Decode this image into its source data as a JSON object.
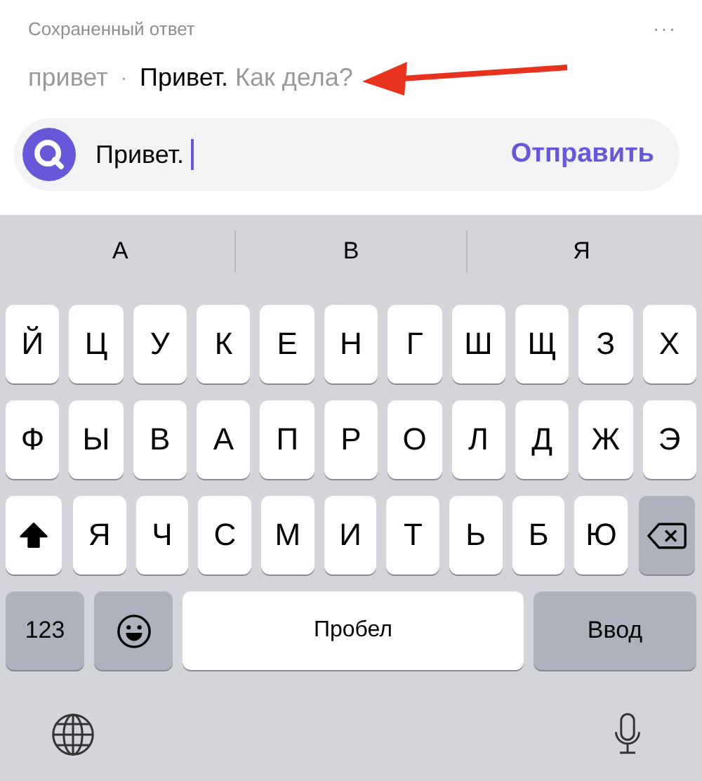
{
  "header": {
    "title": "Сохраненный ответ",
    "more": "···"
  },
  "suggestion": {
    "query": "привет",
    "separator": "·",
    "answer": "**Привет.** Как дела?"
  },
  "input": {
    "value": "Привет.",
    "send": "Отправить"
  },
  "predictions": [
    "А",
    "В",
    "Я"
  ],
  "keyboard": {
    "rows": [
      [
        {
          "kind": "letter",
          "label": "Й"
        },
        {
          "kind": "letter",
          "label": "Ц"
        },
        {
          "kind": "letter",
          "label": "У"
        },
        {
          "kind": "letter",
          "label": "К"
        },
        {
          "kind": "letter",
          "label": "Е"
        },
        {
          "kind": "letter",
          "label": "Н"
        },
        {
          "kind": "letter",
          "label": "Г"
        },
        {
          "kind": "letter",
          "label": "Ш"
        },
        {
          "kind": "letter",
          "label": "Щ"
        },
        {
          "kind": "letter",
          "label": "З"
        },
        {
          "kind": "letter",
          "label": "Х"
        }
      ],
      [
        {
          "kind": "letter",
          "label": "Ф"
        },
        {
          "kind": "letter",
          "label": "Ы"
        },
        {
          "kind": "letter",
          "label": "В"
        },
        {
          "kind": "letter",
          "label": "А"
        },
        {
          "kind": "letter",
          "label": "П"
        },
        {
          "kind": "letter",
          "label": "Р"
        },
        {
          "kind": "letter",
          "label": "О"
        },
        {
          "kind": "letter",
          "label": "Л"
        },
        {
          "kind": "letter",
          "label": "Д"
        },
        {
          "kind": "letter",
          "label": "Ж"
        },
        {
          "kind": "letter",
          "label": "Э"
        }
      ],
      [
        {
          "kind": "shift",
          "on": true
        },
        {
          "kind": "letter",
          "label": "Я"
        },
        {
          "kind": "letter",
          "label": "Ч"
        },
        {
          "kind": "letter",
          "label": "С"
        },
        {
          "kind": "letter",
          "label": "М"
        },
        {
          "kind": "letter",
          "label": "И"
        },
        {
          "kind": "letter",
          "label": "Т"
        },
        {
          "kind": "letter",
          "label": "Ь"
        },
        {
          "kind": "letter",
          "label": "Б"
        },
        {
          "kind": "letter",
          "label": "Ю"
        },
        {
          "kind": "backspace"
        }
      ]
    ],
    "function_keys": [
      {
        "kind": "numbers",
        "label": "123"
      },
      {
        "kind": "emoji"
      },
      {
        "kind": "space",
        "label": "Пробел"
      },
      {
        "kind": "return",
        "label": "Ввод"
      }
    ]
  }
}
